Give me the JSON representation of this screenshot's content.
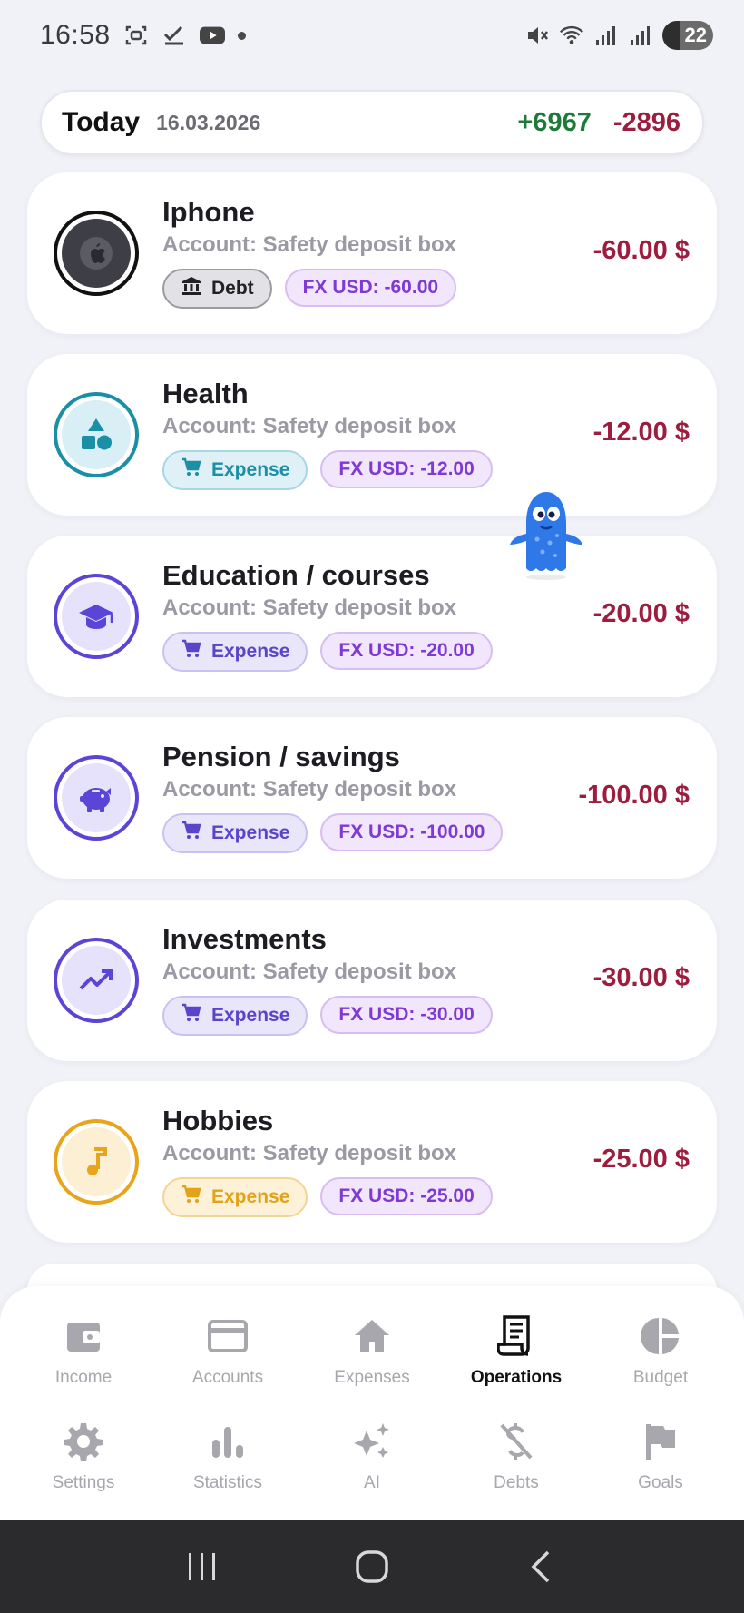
{
  "status_bar": {
    "time": "16:58",
    "battery": "22",
    "left_icons": [
      "screenshot-icon",
      "check-icon",
      "youtube-icon",
      "dot-icon"
    ],
    "right_icons": [
      "mute-icon",
      "wifi-icon",
      "signal-icon",
      "signal-icon"
    ]
  },
  "summary": {
    "label": "Today",
    "date": "16.03.2026",
    "income": "+6967",
    "expense": "-2896"
  },
  "colors": {
    "income_green": "#1f7a3a",
    "expense_red": "#9c1d3e",
    "accent_purple": "#5b45d6"
  },
  "operations": [
    {
      "title": "Iphone",
      "account": "Account: Safety deposit box",
      "type": "Debt",
      "type_icon": "bank-icon",
      "fx": "FX USD: -60.00",
      "amount": "-60.00 $",
      "category_icon": "apple-icon"
    },
    {
      "title": "Health",
      "account": "Account: Safety deposit box",
      "type": "Expense",
      "type_icon": "cart-icon",
      "fx": "FX USD: -12.00",
      "amount": "-12.00 $",
      "category_icon": "shapes-icon"
    },
    {
      "title": "Education / courses",
      "account": "Account: Safety deposit box",
      "type": "Expense",
      "type_icon": "cart-icon",
      "fx": "FX USD: -20.00",
      "amount": "-20.00 $",
      "category_icon": "graduation-cap-icon"
    },
    {
      "title": "Pension / savings",
      "account": "Account: Safety deposit box",
      "type": "Expense",
      "type_icon": "cart-icon",
      "fx": "FX USD: -100.00",
      "amount": "-100.00 $",
      "category_icon": "piggy-bank-icon"
    },
    {
      "title": "Investments",
      "account": "Account: Safety deposit box",
      "type": "Expense",
      "type_icon": "cart-icon",
      "fx": "FX USD: -30.00",
      "amount": "-30.00 $",
      "category_icon": "trending-up-icon"
    },
    {
      "title": "Hobbies",
      "account": "Account: Safety deposit box",
      "type": "Expense",
      "type_icon": "cart-icon",
      "fx": "FX USD: -25.00",
      "amount": "-25.00 $",
      "category_icon": "music-note-icon"
    }
  ],
  "nav": {
    "row1": [
      {
        "label": "Income",
        "icon": "wallet-icon"
      },
      {
        "label": "Accounts",
        "icon": "credit-card-icon"
      },
      {
        "label": "Expenses",
        "icon": "home-icon"
      },
      {
        "label": "Operations",
        "icon": "receipt-icon",
        "active": true
      },
      {
        "label": "Budget",
        "icon": "pie-chart-icon"
      }
    ],
    "row2": [
      {
        "label": "Settings",
        "icon": "gear-icon"
      },
      {
        "label": "Statistics",
        "icon": "bar-chart-icon"
      },
      {
        "label": "AI",
        "icon": "sparkles-icon"
      },
      {
        "label": "Debts",
        "icon": "money-off-icon"
      },
      {
        "label": "Goals",
        "icon": "flag-icon"
      }
    ]
  },
  "android_nav": [
    "recents-button",
    "home-button",
    "back-button"
  ]
}
